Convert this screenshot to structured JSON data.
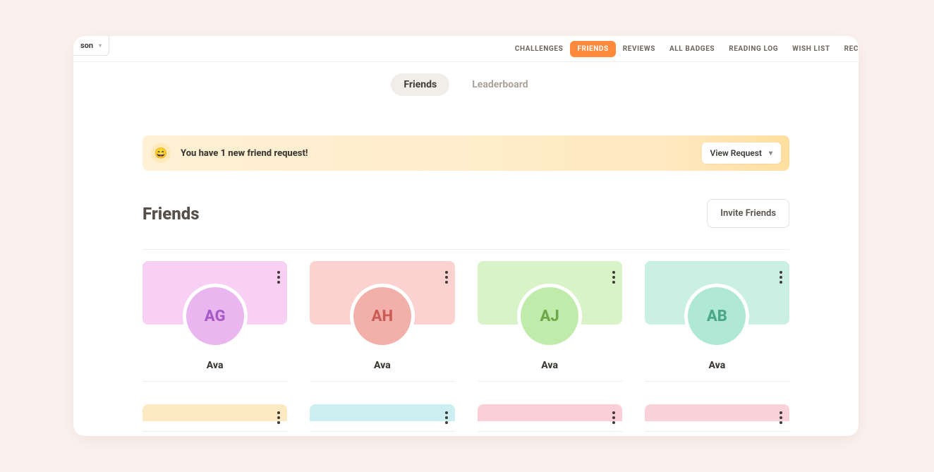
{
  "dropdown": {
    "label": "son",
    "caret": "▾"
  },
  "nav": {
    "items": [
      {
        "label": "CHALLENGES",
        "active": false
      },
      {
        "label": "FRIENDS",
        "active": true
      },
      {
        "label": "REVIEWS",
        "active": false
      },
      {
        "label": "ALL BADGES",
        "active": false
      },
      {
        "label": "READING LOG",
        "active": false
      },
      {
        "label": "WISH LIST",
        "active": false
      },
      {
        "label": "REC",
        "active": false,
        "cut": true
      }
    ]
  },
  "subtabs": {
    "friends": "Friends",
    "leaderboard": "Leaderboard"
  },
  "alert": {
    "emoji": "😄",
    "message": "You have 1 new friend request!",
    "action": "View Request"
  },
  "section": {
    "title": "Friends",
    "invite": "Invite Friends"
  },
  "friends_row1": [
    {
      "initials": "AG",
      "name": "Ava",
      "banner": "bg-pink",
      "avatar": "av-pink"
    },
    {
      "initials": "AH",
      "name": "Ava",
      "banner": "bg-red",
      "avatar": "av-red"
    },
    {
      "initials": "AJ",
      "name": "Ava",
      "banner": "bg-green",
      "avatar": "av-green"
    },
    {
      "initials": "AB",
      "name": "Ava",
      "banner": "bg-teal",
      "avatar": "av-teal"
    }
  ],
  "friends_row2": [
    {
      "banner": "bg-yellow"
    },
    {
      "banner": "bg-cyan"
    },
    {
      "banner": "bg-rose"
    },
    {
      "banner": "bg-rose2"
    }
  ]
}
